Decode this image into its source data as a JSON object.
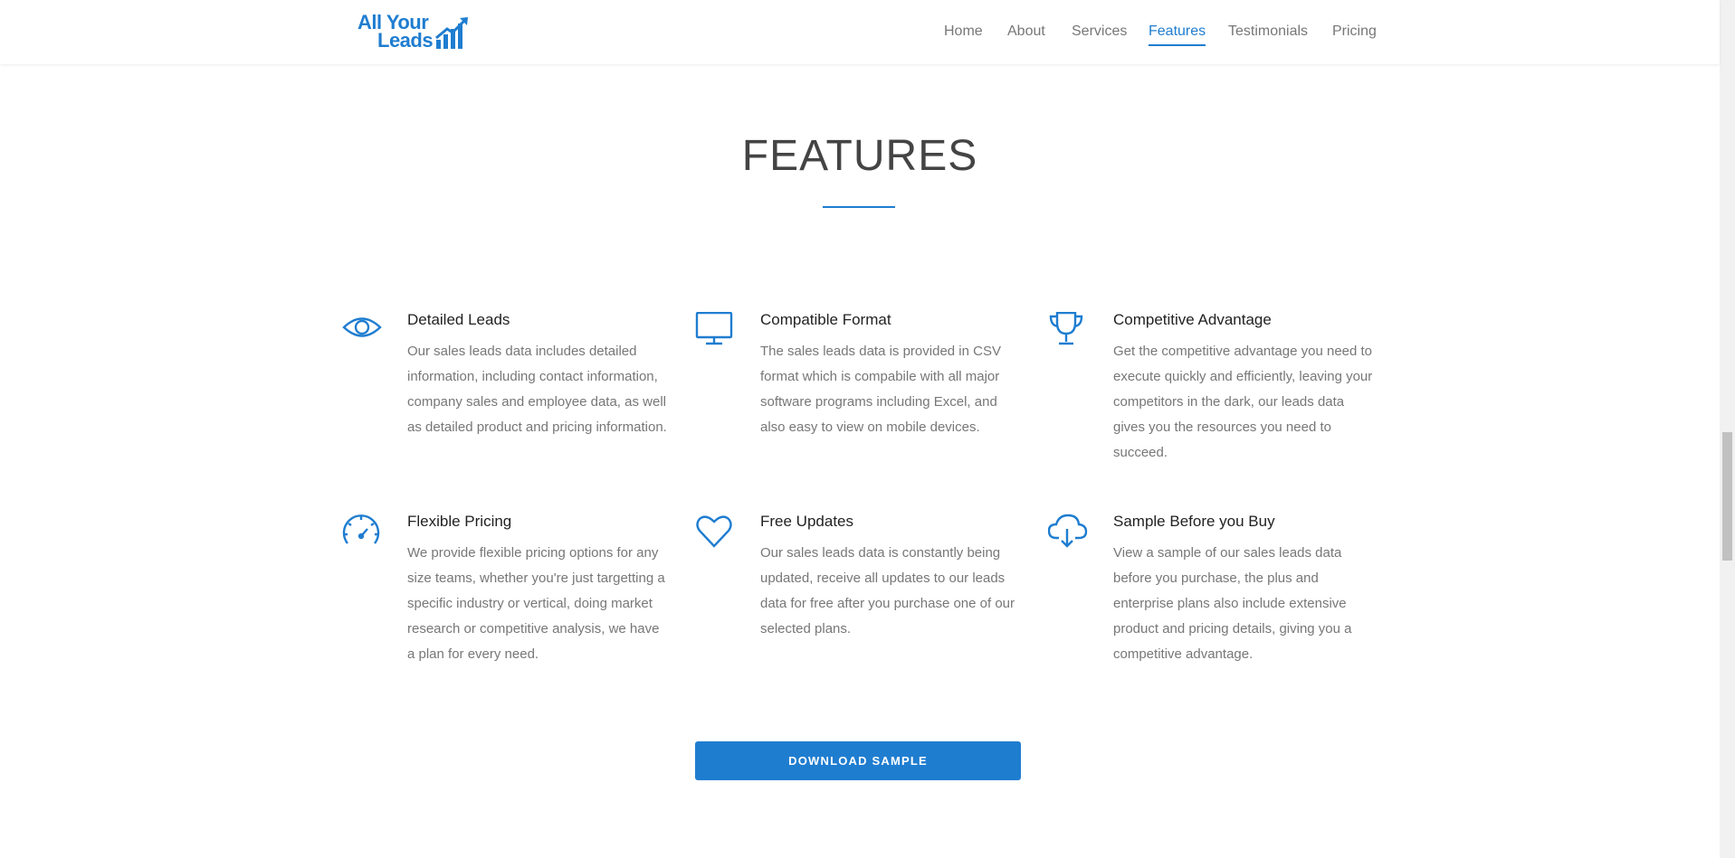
{
  "brand": {
    "line1": "All Your",
    "line2": "Leads",
    "color": "#1f7dd0"
  },
  "nav": {
    "items": [
      {
        "label": "Home"
      },
      {
        "label": "About"
      },
      {
        "label": "Services"
      },
      {
        "label": "Features",
        "active": true
      },
      {
        "label": "Testimonials"
      },
      {
        "label": "Pricing"
      }
    ]
  },
  "section": {
    "title": "FEATURES"
  },
  "features": [
    {
      "icon": "eye-icon",
      "title": "Detailed Leads",
      "text": "Our sales leads data includes detailed information, including contact information, company sales and employee data, as well as detailed product and pricing information."
    },
    {
      "icon": "monitor-icon",
      "title": "Compatible Format",
      "text": "The sales leads data is provided in CSV format which is compabile with all major software programs including Excel, and also easy to view on mobile devices."
    },
    {
      "icon": "trophy-icon",
      "title": "Competitive Advantage",
      "text": "Get the competitive advantage you need to execute quickly and efficiently, leaving your competitors in the dark, our leads data gives you the resources you need to succeed."
    },
    {
      "icon": "speedometer-icon",
      "title": "Flexible Pricing",
      "text": "We provide flexible pricing options for any size teams, whether you're just targetting a specific industry or vertical, doing market research or competitive analysis, we have a plan for every need."
    },
    {
      "icon": "heart-icon",
      "title": "Free Updates",
      "text": "Our sales leads data is constantly being updated, receive all updates to our leads data for free after you purchase one of our selected plans."
    },
    {
      "icon": "cloud-download-icon",
      "title": "Sample Before you Buy",
      "text": "View a sample of our sales leads data before you purchase, the plus and enterprise plans also include extensive product and pricing details, giving you a competitive advantage."
    }
  ],
  "cta": {
    "label": "DOWNLOAD SAMPLE"
  },
  "colors": {
    "accent": "#1f7dd0",
    "text_muted": "#777777",
    "heading": "#444444"
  }
}
